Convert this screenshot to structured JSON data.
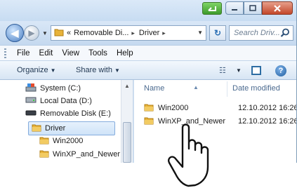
{
  "window": {
    "colors": {
      "frame": "#cfe0f2",
      "close": "#c3472a",
      "accent": "#2c6fb5"
    }
  },
  "caption": {
    "minimize_icon": "minimize-icon",
    "maximize_icon": "maximize-icon",
    "close_icon": "close-icon",
    "green_icon": "green-arrow-icon"
  },
  "address_bar": {
    "overflow": "«",
    "segments": [
      "Removable Di...",
      "Driver"
    ],
    "search_placeholder": "Search Driv..."
  },
  "menu": [
    "File",
    "Edit",
    "View",
    "Tools",
    "Help"
  ],
  "commands": {
    "organize": "Organize",
    "share_with": "Share with"
  },
  "nav_pane": {
    "items": [
      {
        "label": "System (C:)",
        "icon": "system-drive-icon"
      },
      {
        "label": "Local Data (D:)",
        "icon": "drive-icon"
      },
      {
        "label": "Removable Disk (E:)",
        "icon": "removable-drive-icon"
      },
      {
        "label": "Driver",
        "icon": "folder-icon",
        "selected": true
      },
      {
        "label": "Win2000",
        "icon": "folder-icon"
      },
      {
        "label": "WinXP_and_Newer",
        "icon": "folder-icon"
      }
    ]
  },
  "file_list": {
    "columns": {
      "name": "Name",
      "date": "Date modified"
    },
    "rows": [
      {
        "name": "Win2000",
        "date": "12.10.2012 16:26"
      },
      {
        "name": "WinXP_and_Newer",
        "date": "12.10.2012 16:26"
      }
    ]
  }
}
